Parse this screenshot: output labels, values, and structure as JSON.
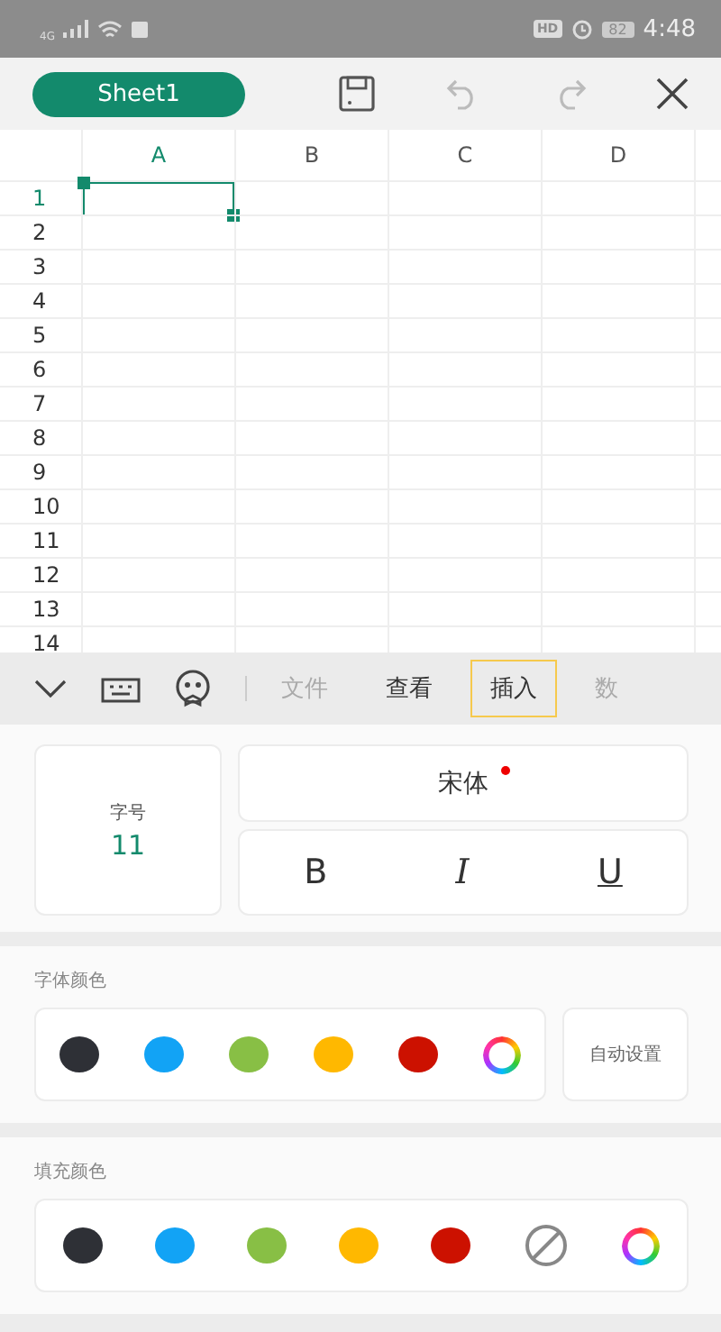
{
  "status_bar": {
    "network": "4G",
    "hd": "HD",
    "battery": "82",
    "time": "4:48"
  },
  "toolbar": {
    "sheet_name": "Sheet1",
    "undo_disabled": true,
    "redo_disabled": true
  },
  "grid": {
    "columns": [
      {
        "label": "A",
        "selected": true
      },
      {
        "label": "B",
        "selected": false
      },
      {
        "label": "C",
        "selected": false
      },
      {
        "label": "D",
        "selected": false
      }
    ],
    "rows": [
      {
        "label": "1",
        "selected": true
      },
      {
        "label": "2",
        "selected": false
      },
      {
        "label": "3",
        "selected": false
      },
      {
        "label": "4",
        "selected": false
      },
      {
        "label": "5",
        "selected": false
      },
      {
        "label": "6",
        "selected": false
      },
      {
        "label": "7",
        "selected": false
      },
      {
        "label": "8",
        "selected": false
      },
      {
        "label": "9",
        "selected": false
      },
      {
        "label": "10",
        "selected": false
      },
      {
        "label": "11",
        "selected": false
      },
      {
        "label": "12",
        "selected": false
      },
      {
        "label": "13",
        "selected": false
      },
      {
        "label": "14",
        "selected": false
      }
    ]
  },
  "tabs": [
    {
      "label": "文件",
      "selected": false,
      "dim": true
    },
    {
      "label": "查看",
      "selected": false,
      "dim": false
    },
    {
      "label": "插入",
      "selected": true,
      "dim": false
    },
    {
      "label": "数",
      "selected": false,
      "dim": true
    }
  ],
  "font_panel": {
    "size_label": "字号",
    "size_value": "11",
    "font_name": "宋体",
    "font_badge": true,
    "styles": [
      {
        "kind": "bold",
        "label": "B"
      },
      {
        "kind": "italic",
        "label": "I"
      },
      {
        "kind": "underline",
        "label": "U"
      }
    ]
  },
  "font_color": {
    "title": "字体颜色",
    "swatches": [
      {
        "kind": "color",
        "color": "#2e3036"
      },
      {
        "kind": "color",
        "color": "#12a3f5"
      },
      {
        "kind": "color",
        "color": "#88bf45"
      },
      {
        "kind": "color",
        "color": "#ffb800"
      },
      {
        "kind": "color",
        "color": "#cc1100"
      },
      {
        "kind": "palette"
      }
    ],
    "auto_button": "自动设置"
  },
  "fill_color": {
    "title": "填充颜色",
    "swatches": [
      {
        "kind": "color",
        "color": "#2e3036"
      },
      {
        "kind": "color",
        "color": "#12a3f5"
      },
      {
        "kind": "color",
        "color": "#88bf45"
      },
      {
        "kind": "color",
        "color": "#ffb800"
      },
      {
        "kind": "color",
        "color": "#cc1100"
      },
      {
        "kind": "none"
      },
      {
        "kind": "palette"
      }
    ]
  }
}
